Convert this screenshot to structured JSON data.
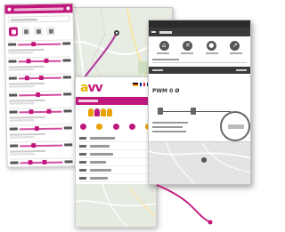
{
  "colors": {
    "brand_magenta": "#c0177c",
    "brand_yellow": "#e8b400",
    "route_line": "#d44aa0",
    "map_bg": "#e8ede4",
    "dark_bar": "#3a3a3a"
  },
  "app_logo": {
    "first": "a",
    "rest": "vv"
  },
  "right_panel": {
    "route_text": "PWM 0 Ø"
  },
  "icons": {
    "left_topbar": "menu-icon",
    "mid_people": "passenger-icon",
    "right_icons": [
      "home-icon",
      "close-icon",
      "pin-icon",
      "share-icon"
    ],
    "map_marker": "map-marker-icon"
  }
}
